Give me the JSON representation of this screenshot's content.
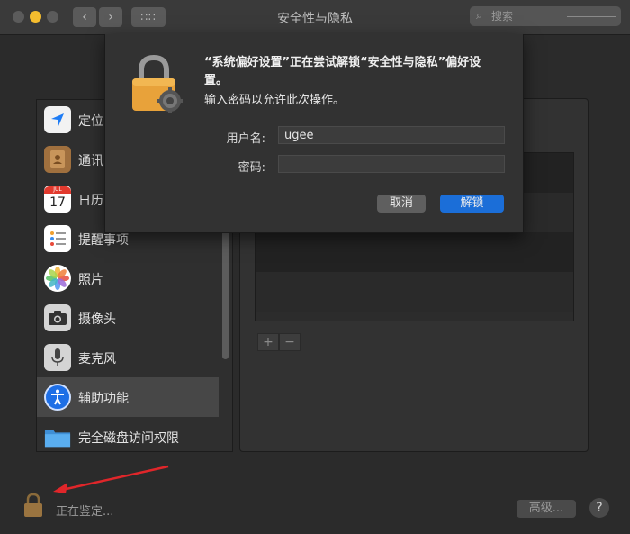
{
  "window": {
    "title": "安全性与隐私"
  },
  "toolbar": {
    "back_icon": "chevron-left-icon",
    "forward_icon": "chevron-right-icon",
    "grid_icon": "grid-icon",
    "search_placeholder": "搜索"
  },
  "sidebar": {
    "items": [
      {
        "label": "定位",
        "icon": "location-arrow-icon",
        "color": "#1e7cf5"
      },
      {
        "label": "通讯",
        "icon": "contacts-book-icon",
        "color": "#9a6a3a"
      },
      {
        "label": "日历",
        "icon": "calendar-icon",
        "color": "#ffffff",
        "day": "17",
        "month": "JUL"
      },
      {
        "label": "提醒事项",
        "icon": "reminders-icon",
        "color": "#ffffff"
      },
      {
        "label": "照片",
        "icon": "photos-icon",
        "color": "#ffffff"
      },
      {
        "label": "摄像头",
        "icon": "camera-icon",
        "color": "#dcdcdc"
      },
      {
        "label": "麦克风",
        "icon": "microphone-icon",
        "color": "#dcdcdc"
      },
      {
        "label": "辅助功能",
        "icon": "accessibility-icon",
        "color": "#1e7cf5",
        "selected": true
      },
      {
        "label": "完全磁盘访问权限",
        "icon": "folder-icon",
        "color": "#4aa3e6"
      }
    ]
  },
  "panel": {
    "add_label": "+",
    "remove_label": "−"
  },
  "footer": {
    "status": "正在鉴定...",
    "advanced_label": "高级...",
    "help_label": "?"
  },
  "dialog": {
    "message": "“系统偏好设置”正在尝试解锁“安全性与隐私”偏好设置。",
    "sub": "输入密码以允许此次操作。",
    "username_label": "用户名:",
    "username_value": "ugee",
    "password_label": "密码:",
    "password_value": "",
    "cancel_label": "取消",
    "unlock_label": "解锁"
  },
  "colors": {
    "accent": "#1b6ed8",
    "lock": "#e8a23a",
    "annotation_arrow": "#e0262a"
  }
}
